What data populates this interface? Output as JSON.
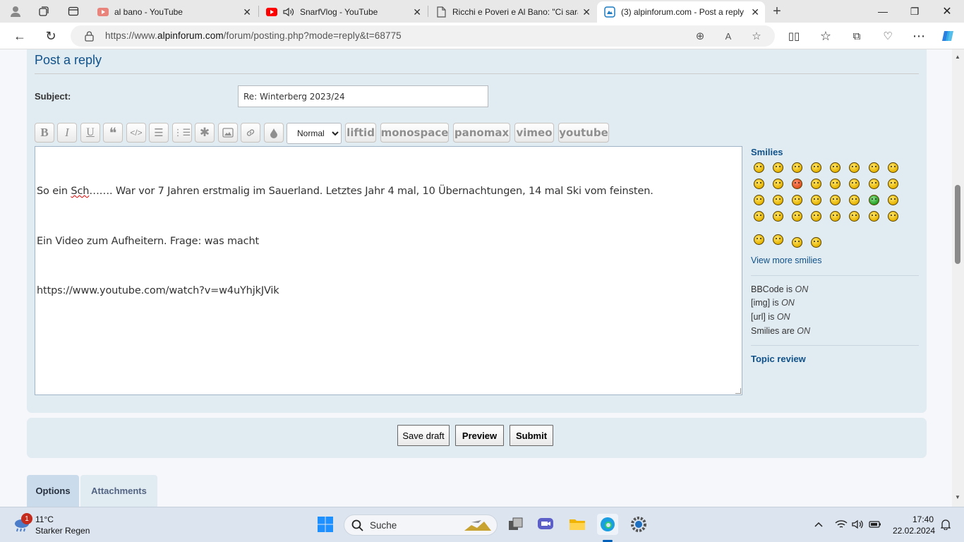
{
  "browser": {
    "tabs": [
      {
        "title": "al bano - YouTube",
        "icon": "youtube-icon"
      },
      {
        "title": "SnarfVlog - YouTube",
        "icon": "youtube-icon",
        "audio": true
      },
      {
        "title": "Ricchi e Poveri e Al Bano: \"Ci sarà",
        "icon": "page-icon"
      },
      {
        "title": "(3) alpinforum.com - Post a reply",
        "icon": "forum-icon",
        "active": true
      }
    ],
    "url_prefix": "https://www.",
    "url_domain": "alpinforum.com",
    "url_path": "/forum/posting.php?mode=reply&t=68775"
  },
  "form": {
    "heading": "Post a reply",
    "subject_label": "Subject:",
    "subject_value": "Re: Winterberg 2023/24",
    "font_size_value": "Normal",
    "font_size_options": [
      "Normal"
    ],
    "custom_tags": [
      "liftid",
      "monospace",
      "panomax",
      "vimeo",
      "youtube"
    ],
    "message_lines": [
      "So ein Sch……. War vor 7 Jahren erstmalig im Sauerland. Letztes Jahr 4 mal, 10 Übernachtungen, 14 mal Ski vom feinsten.",
      "Ein Video zum Aufheitern. Frage: was macht",
      "https://www.youtube.com/watch?v=w4uYhjkJVik"
    ],
    "message_line1_misspelled": "Sch",
    "message_line1_rest": "……. War vor 7 Jahren erstmalig im Sauerland. Letztes Jahr 4 mal, 10 Übernachtungen, 14 mal Ski vom feinsten.",
    "message_line1_prefix": "So ein "
  },
  "sidebar": {
    "smilies_title": "Smilies",
    "view_more": "View more smilies",
    "bbcode_label": "BBCode is ",
    "bbcode_value": "ON",
    "img_label": "[img] is ",
    "img_value": "ON",
    "url_label": "[url] is ",
    "url_value": "ON",
    "smilies_label": "Smilies are ",
    "smilies_value": "ON",
    "topic_review": "Topic review"
  },
  "buttons": {
    "save_draft": "Save draft",
    "preview": "Preview",
    "submit": "Submit"
  },
  "tabs_bottom": {
    "options": "Options",
    "attachments": "Attachments"
  },
  "taskbar": {
    "weather_badge": "1",
    "temperature": "11°C",
    "weather": "Starker Regen",
    "search_placeholder": "Suche",
    "time": "17:40",
    "date": "22.02.2024"
  },
  "colors": {
    "link_blue": "#105289",
    "panel_bg": "#e1ebf2"
  }
}
